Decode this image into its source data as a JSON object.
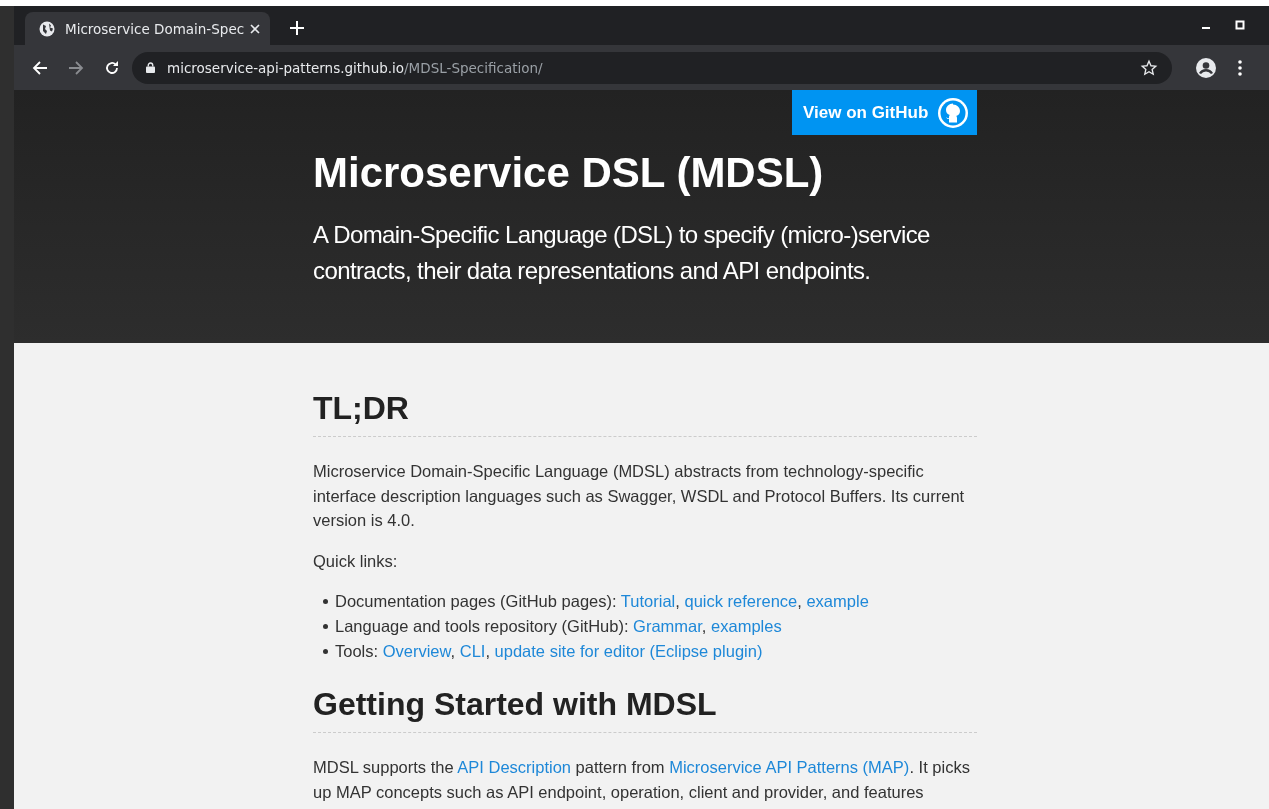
{
  "browser": {
    "tab": {
      "title": "Microservice Domain-Spec",
      "selected": true
    },
    "url": {
      "host": "microservice-api-patterns.github.io",
      "path": "/MDSL-Specification/"
    }
  },
  "header": {
    "github_button": "View on GitHub",
    "title": "Microservice DSL (MDSL)",
    "subtitle": "A Domain-Specific Language (DSL) to specify (micro-)service contracts, their data representations and API endpoints."
  },
  "content": [
    {
      "kind": "heading",
      "text": "TL;DR"
    },
    {
      "kind": "paragraph",
      "parts": [
        {
          "kind": "text",
          "text": "Microservice Domain-Specific Language (MDSL) abstracts from technology-specific interface description languages such as Swagger, WSDL and Protocol Buffers. Its current version is 4.0."
        }
      ]
    },
    {
      "kind": "paragraph",
      "parts": [
        {
          "kind": "text",
          "text": "Quick links:"
        }
      ]
    },
    {
      "kind": "list",
      "items": [
        [
          {
            "kind": "text",
            "text": "Documentation pages (GitHub pages): "
          },
          {
            "kind": "link",
            "text": "Tutorial",
            "after": ", "
          },
          {
            "kind": "link",
            "text": "quick reference",
            "after": ", "
          },
          {
            "kind": "link",
            "text": "example"
          }
        ],
        [
          {
            "kind": "text",
            "text": "Language and tools repository (GitHub): "
          },
          {
            "kind": "link",
            "text": "Grammar",
            "after": ", "
          },
          {
            "kind": "link",
            "text": "examples"
          }
        ],
        [
          {
            "kind": "text",
            "text": "Tools: "
          },
          {
            "kind": "link",
            "text": "Overview",
            "after": ", "
          },
          {
            "kind": "link",
            "text": "CLI",
            "after": ", "
          },
          {
            "kind": "link",
            "text": "update site for editor (Eclipse plugin)"
          }
        ]
      ]
    },
    {
      "kind": "heading",
      "text": "Getting Started with MDSL"
    },
    {
      "kind": "paragraph",
      "parts": [
        {
          "kind": "text",
          "text": "MDSL supports the "
        },
        {
          "kind": "link",
          "text": "API Description"
        },
        {
          "kind": "text",
          "text": " pattern from "
        },
        {
          "kind": "link",
          "text": "Microservice API Patterns (MAP)"
        },
        {
          "kind": "text",
          "text": ". It picks up MAP concepts such as API endpoint, operation, client and provider, and features"
        }
      ]
    }
  ]
}
